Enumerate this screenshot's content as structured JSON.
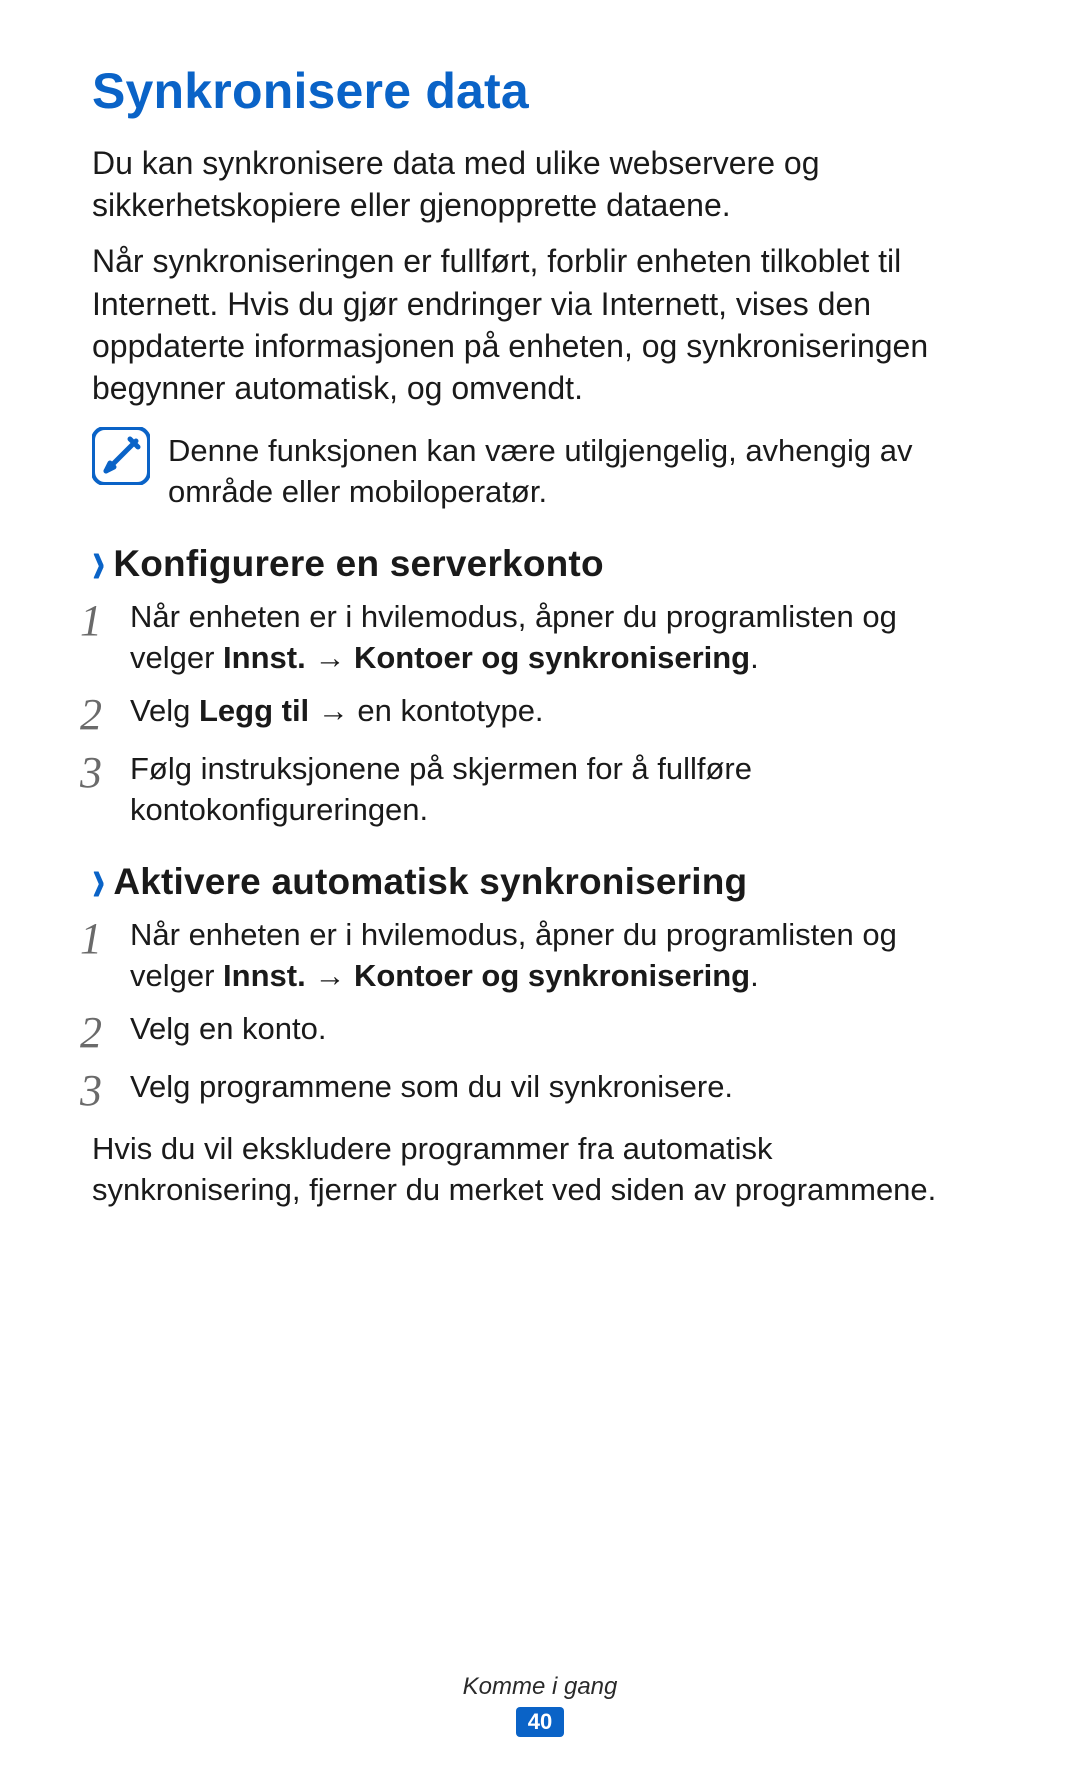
{
  "title": "Synkronisere data",
  "intro_p1": "Du kan synkronisere data med ulike webservere og sikkerhetskopiere eller gjenopprette dataene.",
  "intro_p2": "Når synkroniseringen er fullført, forblir enheten tilkoblet til Internett. Hvis du gjør endringer via Internett, vises den oppdaterte informasjonen på enheten, og synkroniseringen begynner automatisk, og omvendt.",
  "note": "Denne funksjonen kan være utilgjengelig, avhengig av område eller mobiloperatør.",
  "section1": {
    "chevron": "›",
    "title": "Konfigurere en serverkonto",
    "steps": [
      {
        "num": "1",
        "pre": "Når enheten er i hvilemodus, åpner du programlisten og velger ",
        "b1": "Innst.",
        "arrow": " → ",
        "b2": "Kontoer og synkronisering",
        "post": "."
      },
      {
        "num": "2",
        "pre": "Velg ",
        "b1": "Legg til",
        "arrow": " → ",
        "b2": "",
        "post": "en kontotype."
      },
      {
        "num": "3",
        "pre": "Følg instruksjonene på skjermen for å fullføre kontokonfigureringen.",
        "b1": "",
        "arrow": "",
        "b2": "",
        "post": ""
      }
    ]
  },
  "section2": {
    "chevron": "›",
    "title": "Aktivere automatisk synkronisering",
    "steps": [
      {
        "num": "1",
        "pre": "Når enheten er i hvilemodus, åpner du programlisten og velger ",
        "b1": "Innst.",
        "arrow": " → ",
        "b2": "Kontoer og synkronisering",
        "post": "."
      },
      {
        "num": "2",
        "pre": "Velg en konto.",
        "b1": "",
        "arrow": "",
        "b2": "",
        "post": ""
      },
      {
        "num": "3",
        "pre": "Velg programmene som du vil synkronisere.",
        "b1": "",
        "arrow": "",
        "b2": "",
        "post": ""
      }
    ],
    "trailing": "Hvis du vil ekskludere programmer fra automatisk synkronisering, fjerner du merket ved siden av programmene."
  },
  "footer": {
    "caption": "Komme i gang",
    "page": "40"
  }
}
